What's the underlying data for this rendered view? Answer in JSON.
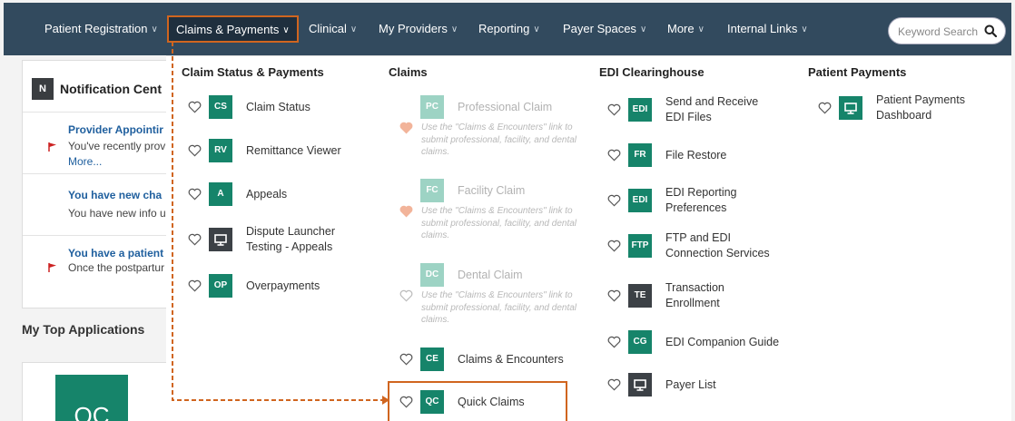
{
  "nav": {
    "items": [
      {
        "label": "Patient Registration"
      },
      {
        "label": "Claims & Payments"
      },
      {
        "label": "Clinical"
      },
      {
        "label": "My Providers"
      },
      {
        "label": "Reporting"
      },
      {
        "label": "Payer Spaces"
      },
      {
        "label": "More"
      },
      {
        "label": "Internal Links"
      }
    ],
    "search_placeholder": "Keyword Search"
  },
  "left": {
    "notif_badge": "N",
    "notif_title": "Notification Cent",
    "notifications": [
      {
        "title": "Provider Appointir",
        "line1": "You've recently prov",
        "more": "More..."
      },
      {
        "title": "You have new cha",
        "line1": "You have new info u"
      },
      {
        "title": "You have a patient",
        "line1": "Once the postpartur"
      }
    ],
    "my_top_title": "My Top Applications",
    "tile_label": "QC"
  },
  "menu": {
    "claim_status": {
      "heading": "Claim Status & Payments",
      "items": [
        {
          "badge": "CS",
          "label": "Claim Status"
        },
        {
          "badge": "RV",
          "label": "Remittance Viewer"
        },
        {
          "badge": "A",
          "label": "Appeals"
        },
        {
          "badge_icon": "monitor-icon",
          "label1": "Dispute Launcher",
          "label2": "Testing - Appeals"
        },
        {
          "badge": "OP",
          "label": "Overpayments"
        }
      ]
    },
    "claims": {
      "heading": "Claims",
      "items": [
        {
          "badge": "PC",
          "label": "Professional Claim",
          "note": "Use the \"Claims & Encounters\" link to submit professional, facility, and dental claims."
        },
        {
          "badge": "FC",
          "label": "Facility Claim",
          "note": "Use the \"Claims & Encounters\" link to submit professional, facility, and dental claims."
        },
        {
          "badge": "DC",
          "label": "Dental Claim",
          "note": "Use the \"Claims & Encounters\" link to submit professional, facility, and dental claims."
        },
        {
          "badge": "CE",
          "label": "Claims & Encounters"
        },
        {
          "badge": "QC",
          "label": "Quick Claims"
        }
      ]
    },
    "edi": {
      "heading": "EDI Clearinghouse",
      "items": [
        {
          "badge": "EDI",
          "label1": "Send and Receive",
          "label2": "EDI Files"
        },
        {
          "badge": "FR",
          "label": "File Restore"
        },
        {
          "badge": "EDI",
          "label1": "EDI Reporting",
          "label2": "Preferences"
        },
        {
          "badge": "FTP",
          "label1": "FTP and EDI",
          "label2": "Connection Services"
        },
        {
          "badge": "TE",
          "label1": "Transaction",
          "label2": "Enrollment"
        },
        {
          "badge": "CG",
          "label": "EDI Companion Guide"
        },
        {
          "badge_icon": "monitor-icon",
          "label": "Payer List"
        }
      ]
    },
    "patient_payments": {
      "heading": "Patient Payments",
      "items": [
        {
          "badge_icon": "monitor-icon",
          "label1": "Patient Payments",
          "label2": "Dashboard"
        }
      ]
    }
  },
  "colors": {
    "nav_bg": "#324a5e",
    "badge_green": "#16846a",
    "highlight": "#d0651f",
    "favorite_heart": "#f2b49a"
  }
}
